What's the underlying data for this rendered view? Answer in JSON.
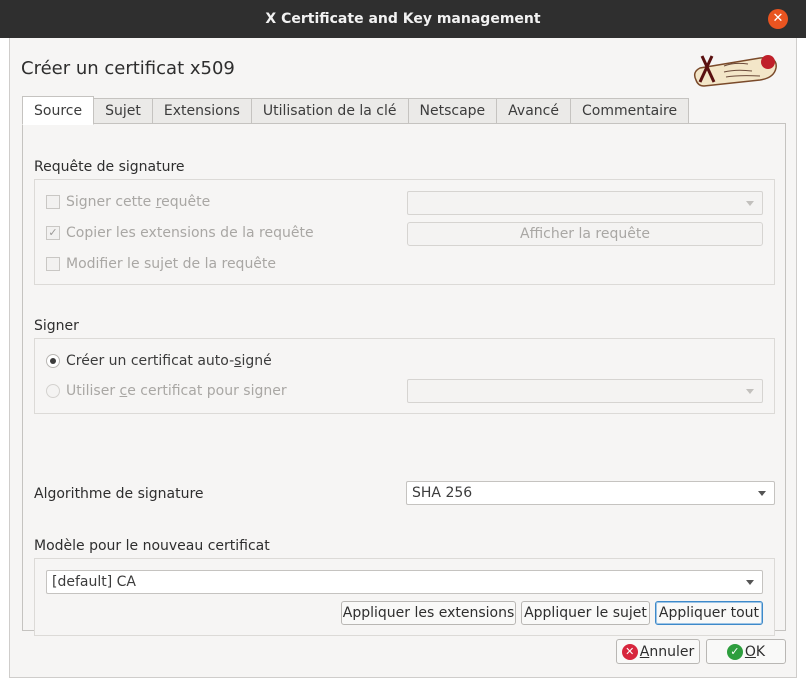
{
  "window": {
    "title": "X Certificate and Key management",
    "close_glyph": "✕"
  },
  "dialog": {
    "title": "Créer un certificat x509"
  },
  "tabs": [
    {
      "label": "Source",
      "active": true
    },
    {
      "label": "Sujet"
    },
    {
      "label": "Extensions"
    },
    {
      "label": "Utilisation de la clé"
    },
    {
      "label": "Netscape"
    },
    {
      "label": "Avancé"
    },
    {
      "label": "Commentaire"
    }
  ],
  "signing_request": {
    "label": "Requête de signature",
    "sign_request": {
      "label_pre": "Signer cette ",
      "label_u": "r",
      "label_post": "equête",
      "checked": false
    },
    "copy_extensions": {
      "label": "Copier les extensions de la requête",
      "checked": true
    },
    "modify_subject": {
      "label": "Modifier le sujet de la requête",
      "checked": false
    },
    "request_select_value": "",
    "show_request_button": "Afficher la requête"
  },
  "sign": {
    "label": "Signer",
    "self_signed": {
      "label_pre": "Créer un certificat auto-",
      "label_u": "s",
      "label_post": "igné",
      "checked": true
    },
    "use_ca": {
      "label_pre": "Utiliser ",
      "label_u": "c",
      "label_post": "e certificat pour signer",
      "checked": false
    },
    "ca_select_value": ""
  },
  "algorithm": {
    "label": "Algorithme de signature",
    "value": "SHA 256"
  },
  "template": {
    "label": "Modèle pour le nouveau certificat",
    "value": "[default] CA",
    "apply_extensions": "Appliquer les extensions",
    "apply_subject": "Appliquer le sujet",
    "apply_all": "Appliquer tout"
  },
  "footer": {
    "cancel": {
      "u": "A",
      "rest": "nnuler",
      "icon": "✕",
      "icon_color": "#d7263d"
    },
    "ok": {
      "u": "O",
      "rest": "K",
      "icon": "✓",
      "icon_color": "#2e9e3e"
    }
  }
}
